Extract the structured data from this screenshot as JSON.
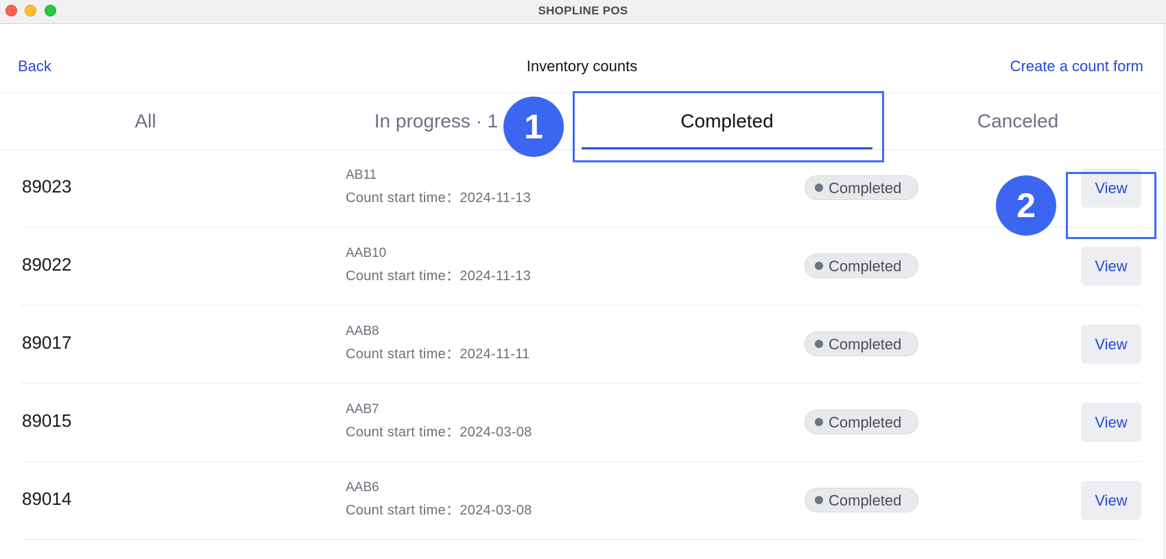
{
  "window": {
    "title": "SHOPLINE POS"
  },
  "header": {
    "back_label": "Back",
    "title": "Inventory counts",
    "create_label": "Create a count form"
  },
  "tabs": [
    {
      "label": "All",
      "active": false
    },
    {
      "label": "In progress · 1",
      "active": false
    },
    {
      "label": "Completed",
      "active": true
    },
    {
      "label": "Canceled",
      "active": false
    }
  ],
  "annotations": {
    "step1": "1",
    "step2": "2"
  },
  "rows": [
    {
      "id": "89023",
      "name": "AB11",
      "start": "Count start time：2024-11-13",
      "status": "Completed",
      "action": "View"
    },
    {
      "id": "89022",
      "name": "AAB10",
      "start": "Count start time：2024-11-13",
      "status": "Completed",
      "action": "View"
    },
    {
      "id": "89017",
      "name": "AAB8",
      "start": "Count start time：2024-11-11",
      "status": "Completed",
      "action": "View"
    },
    {
      "id": "89015",
      "name": "AAB7",
      "start": "Count start time：2024-03-08",
      "status": "Completed",
      "action": "View"
    },
    {
      "id": "89014",
      "name": "AAB6",
      "start": "Count start time：2024-03-08",
      "status": "Completed",
      "action": "View"
    }
  ],
  "colors": {
    "link": "#2749d6",
    "accent": "#2c4fd0",
    "annotation": "#3a66f2"
  }
}
